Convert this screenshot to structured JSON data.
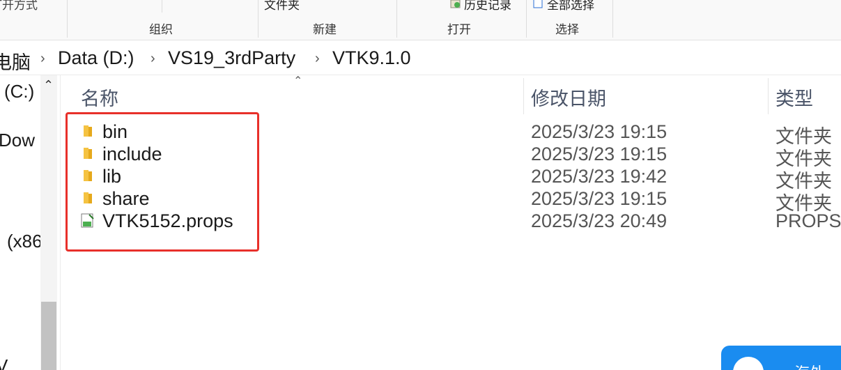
{
  "ribbon": {
    "top_texts": [
      "打开方式",
      "文件夹",
      "历史记录",
      "全部选择"
    ],
    "groups": [
      "组织",
      "新建",
      "打开",
      "选择"
    ]
  },
  "breadcrumb": [
    "电脑",
    "Data (D:)",
    "VS19_3rdParty",
    "VTK9.1.0"
  ],
  "nav_pane": {
    "items": [
      "(C:)",
      "Dow",
      "(x86",
      "V"
    ]
  },
  "columns": {
    "name": "名称",
    "date": "修改日期",
    "type": "类型"
  },
  "files": [
    {
      "name": "bin",
      "date": "2025/3/23 19:15",
      "type": "文件夹",
      "icon": "folder-icon"
    },
    {
      "name": "include",
      "date": "2025/3/23 19:15",
      "type": "文件夹",
      "icon": "folder-icon"
    },
    {
      "name": "lib",
      "date": "2025/3/23 19:42",
      "type": "文件夹",
      "icon": "folder-icon"
    },
    {
      "name": "share",
      "date": "2025/3/23 19:15",
      "type": "文件夹",
      "icon": "folder-icon"
    },
    {
      "name": "VTK5152.props",
      "date": "2025/3/23 20:49",
      "type": "PROPS",
      "icon": "props-file-icon"
    }
  ],
  "floating_button": {
    "label": "海外"
  },
  "colors": {
    "highlight": "#e8302a",
    "folder": "#f5c342",
    "accent": "#1a8cf0"
  }
}
